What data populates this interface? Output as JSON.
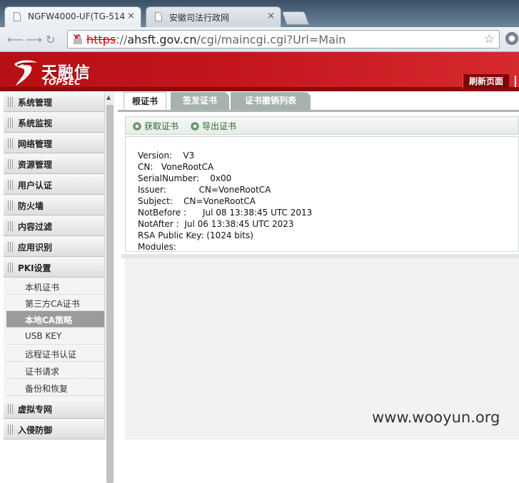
{
  "browser": {
    "tabs": [
      {
        "title": "NGFW4000-UF(TG-514"
      },
      {
        "title": "安徽司法行政网"
      }
    ],
    "url": {
      "scheme": "https",
      "sep": "://",
      "host": "ahsft.gov.cn",
      "path": "/cgi/maincgi.cgi?Url=Main"
    }
  },
  "header": {
    "logo_cn": "天融信",
    "logo_en": "TOPSEC",
    "refresh_label": "刷新页面"
  },
  "sidebar": {
    "items_top": [
      "系统管理",
      "系统监视",
      "网络管理",
      "资源管理",
      "用户认证",
      "防火墙",
      "内容过滤",
      "应用识别",
      "PKI设置"
    ],
    "pki_sub": [
      "本机证书",
      "第三方CA证书",
      "本地CA策略",
      "USB KEY",
      "远程证书认证",
      "证书请求",
      "备份和恢复"
    ],
    "items_bottom": [
      "虚拟专网",
      "入侵防御"
    ]
  },
  "main": {
    "tabs": [
      "根证书",
      "签发证书",
      "证书撤销列表"
    ],
    "actions": [
      "获取证书",
      "导出证书"
    ],
    "cert": {
      "version": "Version:    V3",
      "cn": "CN:   VoneRootCA",
      "serial": "SerialNumber:    0x00",
      "issuer": "Issuer:            CN=VoneRootCA",
      "subject": "Subject:    CN=VoneRootCA",
      "notbefore": "NotBefore :      Jul 08 13:38:45 UTC 2013",
      "notafter": "NotAfter :  Jul 06 13:38:45 UTC 2023",
      "rsa": "RSA Public Key: (1024 bits)",
      "modules": "Modules:"
    }
  },
  "watermark": "www.wooyun.org"
}
